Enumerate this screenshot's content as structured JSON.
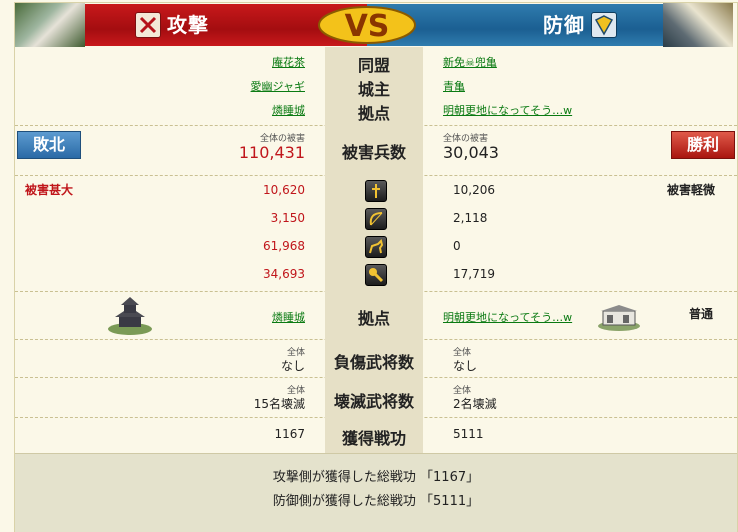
{
  "header": {
    "attack_label": "攻撃",
    "defense_label": "防御",
    "vs_label": "VS",
    "attack_color": "#c8191b",
    "defense_color": "#2f7cae"
  },
  "info": {
    "alliance_label": "同盟",
    "lord_label": "城主",
    "base_label": "拠点",
    "attack_alliance": "庵花茶",
    "attack_lord": "愛幽ジャギ",
    "attack_base": "燐睡城",
    "defense_alliance": "新免☠兜亀",
    "defense_lord": "青亀",
    "defense_base": "明朝更地になってそう…w"
  },
  "damage": {
    "label": "被害兵数",
    "total_caption": "全体の被害",
    "attack_total": "110,431",
    "defense_total": "30,043",
    "attack_result": "敗北",
    "defense_result": "勝利",
    "attack_severity": "被害甚大",
    "defense_severity": "被害軽微",
    "units": [
      {
        "icon": "infantry-icon",
        "attack": "10,620",
        "defense": "10,206"
      },
      {
        "icon": "bow-icon",
        "attack": "3,150",
        "defense": "2,118"
      },
      {
        "icon": "cavalry-icon",
        "attack": "61,968",
        "defense": "0"
      },
      {
        "icon": "siege-icon",
        "attack": "34,693",
        "defense": "17,719"
      }
    ]
  },
  "base_row": {
    "label": "拠点",
    "attack_base": "燐睡城",
    "defense_base": "明朝更地になってそう…w",
    "defense_status": "普通"
  },
  "wounded": {
    "label": "負傷武将数",
    "caption": "全体",
    "attack": "なし",
    "defense": "なし"
  },
  "destroyed": {
    "label": "壊滅武将数",
    "caption": "全体",
    "attack": "15名壊滅",
    "defense": "2名壊滅"
  },
  "merit": {
    "label": "獲得戦功",
    "attack": "1167",
    "defense": "5111"
  },
  "summary": {
    "attack_line": "攻撃側が獲得した総戦功 「1167」",
    "defense_line": "防御側が獲得した総戦功 「5111」"
  }
}
